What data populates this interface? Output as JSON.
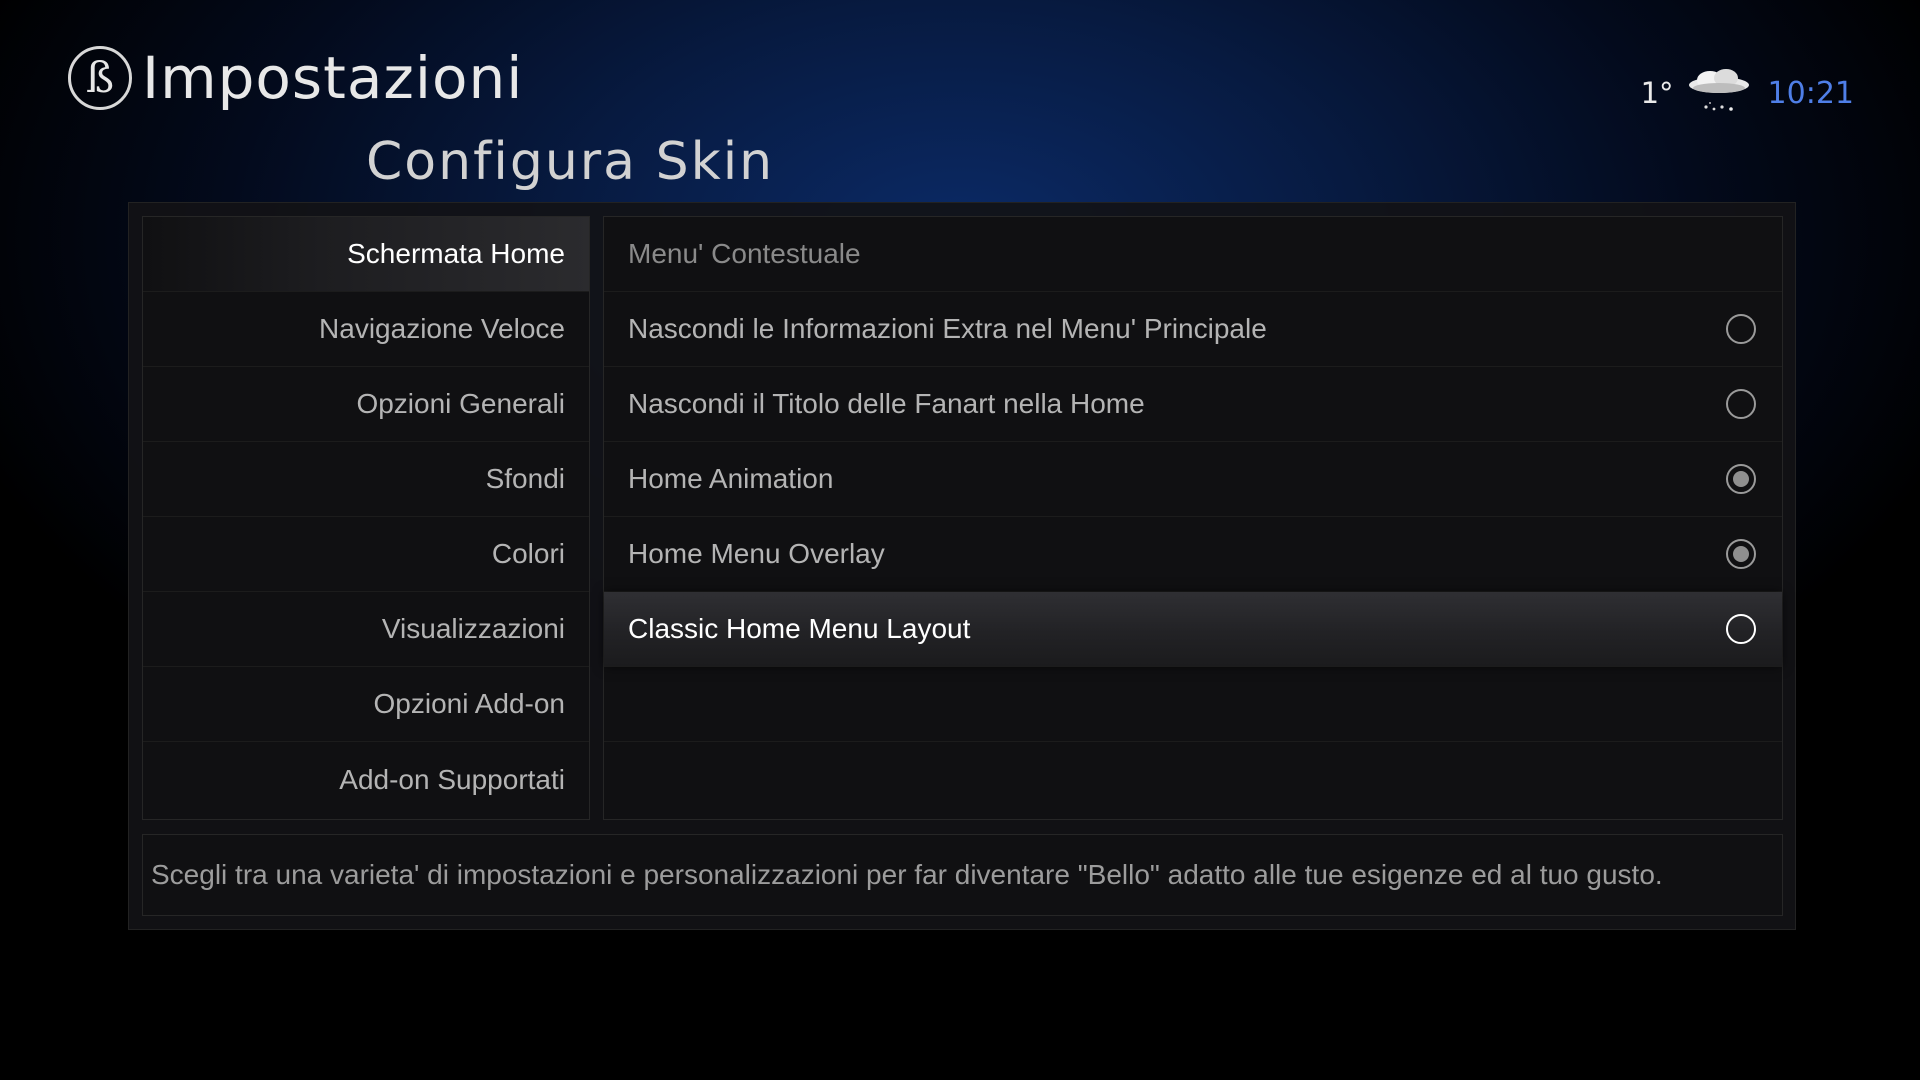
{
  "header": {
    "logo_glyph": "ß",
    "app_title": "Impostazioni",
    "page_title": "Configura  Skin"
  },
  "status": {
    "temperature": "1°",
    "weather_icon": "snow-cloud-icon",
    "clock": "10:21",
    "clock_color": "#4f7fe8"
  },
  "sidebar": {
    "items": [
      {
        "label": "Schermata Home",
        "active": true
      },
      {
        "label": "Navigazione Veloce",
        "active": false
      },
      {
        "label": "Opzioni Generali",
        "active": false
      },
      {
        "label": "Sfondi",
        "active": false
      },
      {
        "label": "Colori",
        "active": false
      },
      {
        "label": "Visualizzazioni",
        "active": false
      },
      {
        "label": "Opzioni Add-on",
        "active": false
      },
      {
        "label": "Add-on Supportati",
        "active": false
      }
    ]
  },
  "options": {
    "items": [
      {
        "label": "Menu' Contestuale",
        "type": "header",
        "checked": null
      },
      {
        "label": "Nascondi le Informazioni Extra nel Menu' Principale",
        "type": "radio",
        "checked": false
      },
      {
        "label": "Nascondi il Titolo delle Fanart nella Home",
        "type": "radio",
        "checked": false
      },
      {
        "label": "Home Animation",
        "type": "radio",
        "checked": true
      },
      {
        "label": "Home Menu Overlay",
        "type": "radio",
        "checked": true
      },
      {
        "label": "Classic Home Menu Layout",
        "type": "radio",
        "checked": false,
        "focused": true
      }
    ]
  },
  "description": "Scegli tra una varieta' di impostazioni e personalizzazioni per far diventare \"Bello\" adatto alle tue esigenze ed al tuo gusto."
}
